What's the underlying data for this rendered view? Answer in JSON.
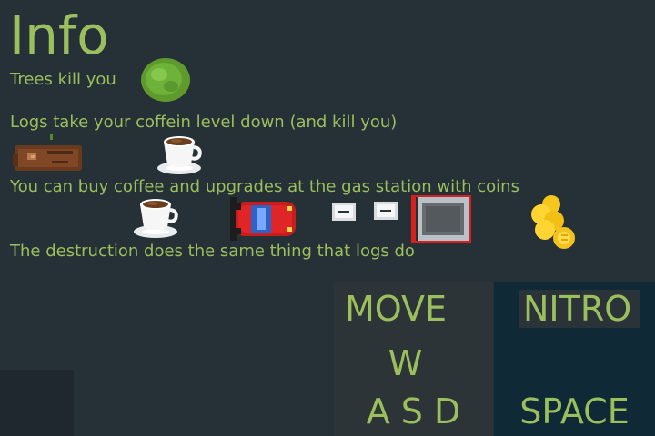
{
  "title": "Info",
  "info_lines": {
    "trees": "Trees kill you",
    "logs": "Logs take your coffein level down (and kill you)",
    "buy": "You can buy coffee and upgrades at the gas station with coins",
    "destruction": "The destruction does the same thing that logs do"
  },
  "controls": {
    "move": {
      "label": "MOVE",
      "key_top": "W",
      "key_bottom": "A S D"
    },
    "nitro": {
      "label": "NITRO",
      "key": "SPACE"
    }
  },
  "icons": [
    "tree-icon",
    "log-icon",
    "coffee-cup-icon",
    "car-icon",
    "upgrade-icon",
    "gas-station-icon",
    "coins-icon"
  ],
  "colors": {
    "background": "#263037",
    "text": "#9cbf5d",
    "move_panel": "#2d3438",
    "nitro_panel": "#0f2a36"
  }
}
